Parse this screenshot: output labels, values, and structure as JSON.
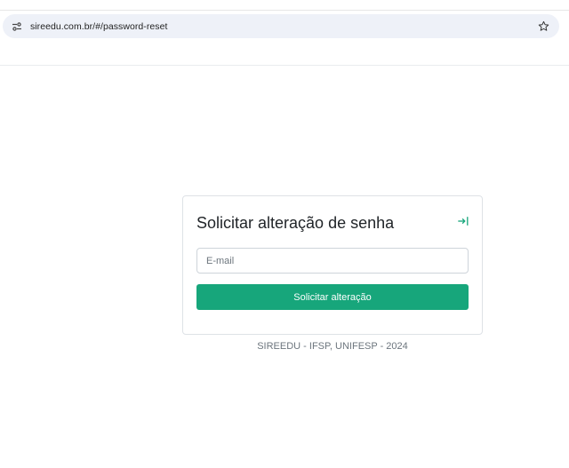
{
  "browser": {
    "url": "sireedu.com.br/#/password-reset"
  },
  "card": {
    "title": "Solicitar alteração de senha",
    "email_placeholder": "E-mail",
    "submit_label": "Solicitar alteração"
  },
  "footer": {
    "text": "SIREEDU - IFSP, UNIFESP - 2024"
  },
  "colors": {
    "primary": "#17a67b",
    "address_bar_bg": "#eef1f8",
    "card_border": "#dee2e6"
  },
  "icons": {
    "site_info": "tune-icon",
    "bookmark": "star-outline-icon",
    "login": "login-arrow-icon"
  }
}
